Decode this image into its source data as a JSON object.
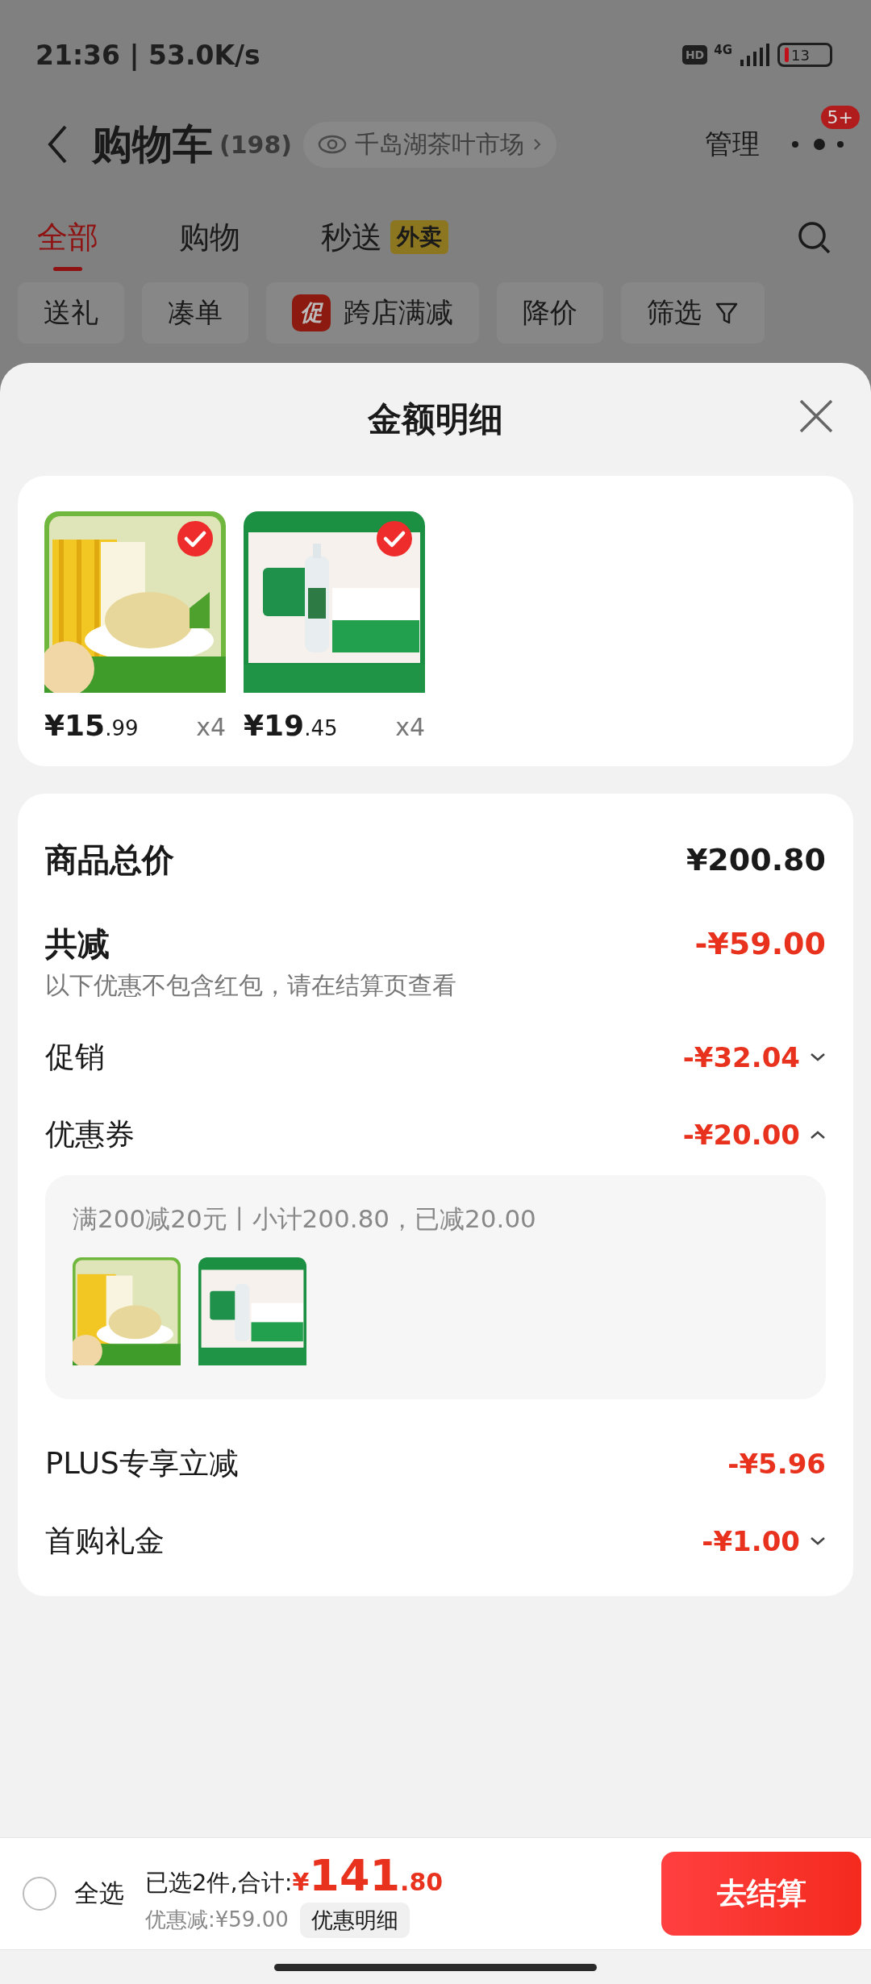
{
  "status_bar": {
    "time": "21:36 | 53.0K/s",
    "hd": "HD",
    "network": "4G",
    "battery": "13"
  },
  "header": {
    "title": "购物车",
    "count": "(198)",
    "store": "千岛湖茶叶市场",
    "manage": "管理",
    "badge": "5+"
  },
  "tabs": [
    {
      "label": "全部",
      "selected": true
    },
    {
      "label": "购物",
      "selected": false
    },
    {
      "label": "秒送",
      "selected": false,
      "tag": "外卖"
    }
  ],
  "filters": [
    {
      "kind": "plain",
      "label": "送礼"
    },
    {
      "kind": "plain",
      "label": "凑单"
    },
    {
      "kind": "promo",
      "tag": "促",
      "label": "跨店满减"
    },
    {
      "kind": "plain",
      "label": "降价"
    },
    {
      "kind": "filter",
      "label": "筛选"
    }
  ],
  "sheet": {
    "title": "金额明细",
    "products": [
      {
        "kind": "picture",
        "checked": true,
        "price_main": "¥15",
        "price_cents": ".99",
        "quantity": "x4"
      },
      {
        "kind": "picture",
        "checked": true,
        "price_main": "¥19",
        "price_cents": ".45",
        "quantity": "x4"
      }
    ],
    "total_label": "商品总价",
    "total": "¥200.80",
    "saved_label": "共减",
    "saved": "-¥59.00",
    "note": "以下优惠不包含红包，请在结算页查看",
    "lines": [
      {
        "kind": "toggle",
        "label": "促销",
        "amount": "-¥32.04",
        "expanded": false
      },
      {
        "kind": "toggle",
        "label": "优惠券",
        "amount": "-¥20.00",
        "expanded": true,
        "detail": {
          "text": "满200减20元丨小计200.80，已减20.00"
        }
      },
      {
        "kind": "plain",
        "label": "PLUS专享立减",
        "amount": "-¥5.96"
      },
      {
        "kind": "toggle",
        "label": "首购礼金",
        "amount": "-¥1.00",
        "expanded": false
      }
    ]
  },
  "checkout": {
    "select_all": {
      "label": "全选",
      "checked": false
    },
    "summary": "已选2件,合计:",
    "currency": "¥",
    "total_main": "141",
    "total_cents": ".80",
    "discount": "优惠减:¥59.00",
    "detail_button": "优惠明细",
    "button": "去结算"
  }
}
